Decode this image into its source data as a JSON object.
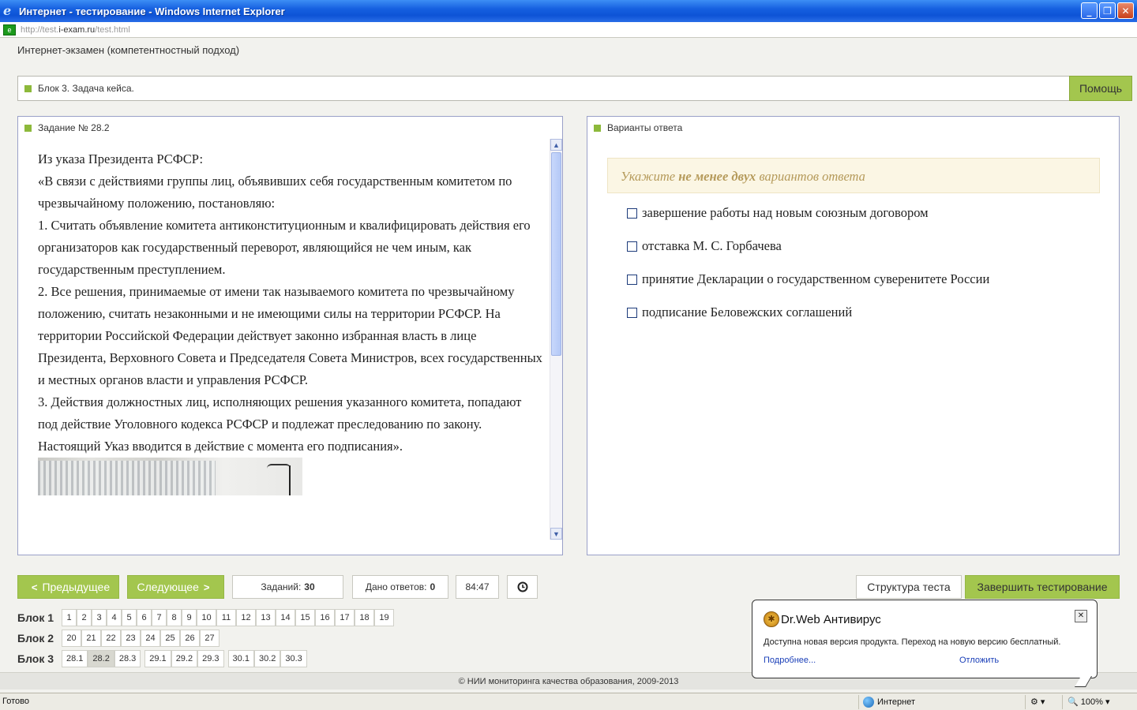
{
  "window": {
    "title": "Интернет - тестирование - Windows Internet Explorer",
    "url_prefix": "http://test.",
    "url_host": "i-exam.ru",
    "url_path": "/test.html"
  },
  "app": {
    "title": "Интернет-экзамен (компетентностный подход)"
  },
  "block": {
    "label": "Блок 3. Задача кейса.",
    "help_label": "Помощь"
  },
  "task": {
    "title": "Задание № 28.2",
    "paragraphs": [
      "Из указа Президента РСФСР:",
      "«В связи с действиями группы лиц, объявивших себя государственным комитетом по чрезвычайному положению, постановляю:",
      "1. Считать объявление комитета антиконституционным и квалифицировать действия его организаторов как государственный переворот, являющийся не чем иным, как государственным преступлением.",
      "2. Все решения, принимаемые от имени так называемого комитета по чрезвычайному положению, считать незаконными и не имеющими силы на территории РСФСР. На территории Российской Федерации действует законно избранная власть в лице Президента, Верховного Совета и Председателя Совета Министров, всех государственных и местных органов власти и управления РСФСР.",
      "3. Действия должностных лиц, исполняющих решения указанного комитета, попадают под действие Уголовного кодекса РСФСР и подлежат преследованию по закону.",
      "Настоящий Указ вводится в действие с момента его подписания»."
    ]
  },
  "answers": {
    "title": "Варианты ответа",
    "hint_pre": "Укажите",
    "hint_bold": "не менее двух",
    "hint_post": "вариантов ответа",
    "options": [
      "завершение работы над новым союзным договором",
      "отставка М. С. Горбачева",
      "принятие Декларации о государственном суверенитете России",
      "подписание Беловежских соглашений"
    ]
  },
  "nav": {
    "prev_label": "Предыдущее",
    "next_label": "Следующее",
    "tasks_label": "Заданий:",
    "tasks_count": "30",
    "answered_label": "Дано ответов:",
    "answered_count": "0",
    "timer": "84:47",
    "timer_icon": "clock-icon",
    "structure_label": "Структура теста",
    "finish_label": "Завершить тестирование"
  },
  "blocks": {
    "block1_label": "Блок 1",
    "block1": [
      "1",
      "2",
      "3",
      "4",
      "5",
      "6",
      "7",
      "8",
      "9",
      "10",
      "11",
      "12",
      "13",
      "14",
      "15",
      "16",
      "17",
      "18",
      "19"
    ],
    "block2_label": "Блок 2",
    "block2": [
      "20",
      "21",
      "22",
      "23",
      "24",
      "25",
      "26",
      "27"
    ],
    "block3_label": "Блок 3",
    "block3_groups": [
      [
        "28.1",
        "28.2",
        "28.3"
      ],
      [
        "29.1",
        "29.2",
        "29.3"
      ],
      [
        "30.1",
        "30.2",
        "30.3"
      ]
    ],
    "active": "28.2"
  },
  "footer": "© НИИ мониторинга качества образования, 2009-2013",
  "popup": {
    "title": "Dr.Web Антивирус",
    "message": "Доступна новая версия продукта. Переход на новую версию бесплатный.",
    "more_link": "Подробнее...",
    "postpone_link": "Отложить"
  },
  "status": {
    "ready": "Готово",
    "zone": "Интернет",
    "zoom": "100%"
  },
  "colors": {
    "accent": "#a3c64e",
    "titlebar": "#1660e0",
    "hint_bg": "#fbf6e4"
  }
}
